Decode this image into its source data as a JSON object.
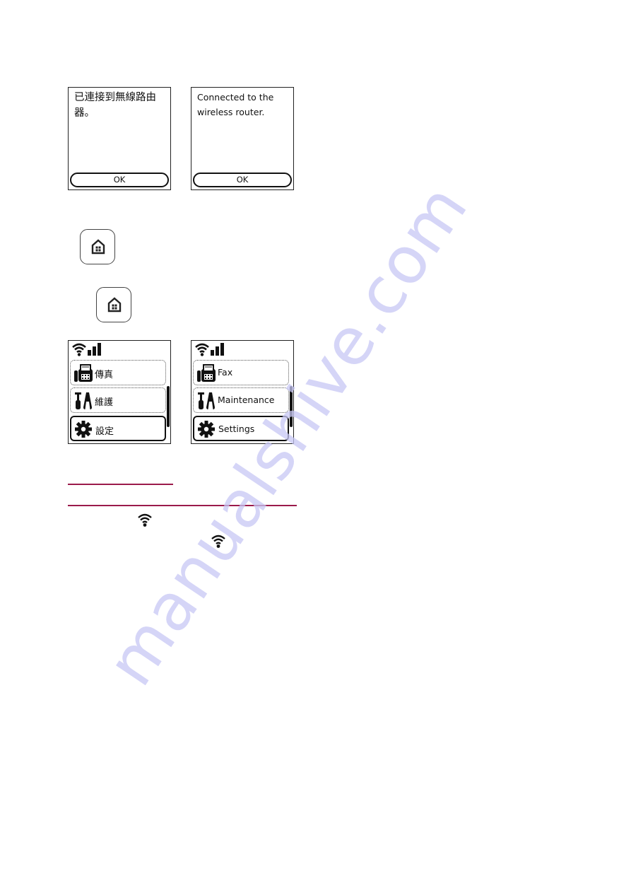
{
  "screens_confirmation": [
    {
      "language": "zh-TW",
      "message": "已連接到無線路由器。",
      "ok_label": "OK"
    },
    {
      "language": "en",
      "message": "Connected to the wireless router.",
      "ok_label": "OK"
    }
  ],
  "home_buttons": [
    {
      "icon": "home-icon"
    },
    {
      "icon": "home-icon"
    }
  ],
  "screens_home_menu": [
    {
      "language": "zh-TW",
      "status_icons": [
        "wifi-icon",
        "signal-strength-icon"
      ],
      "items": [
        {
          "icon": "fax-icon",
          "label": "傳真",
          "selected": false
        },
        {
          "icon": "maintenance-icon",
          "label": "維護",
          "selected": false
        },
        {
          "icon": "gear-icon",
          "label": "設定",
          "selected": true
        }
      ]
    },
    {
      "language": "en",
      "status_icons": [
        "wifi-icon",
        "signal-strength-icon"
      ],
      "items": [
        {
          "icon": "fax-icon",
          "label": "Fax",
          "selected": false
        },
        {
          "icon": "maintenance-icon",
          "label": "Maintenance",
          "selected": false
        },
        {
          "icon": "gear-icon",
          "label": "Settings",
          "selected": true
        }
      ]
    }
  ],
  "inline_icons": [
    "wifi-icon",
    "wifi-icon"
  ],
  "colors": {
    "rule": "#9b1a4b",
    "watermark": "#c8c8f5"
  },
  "watermark": {
    "text": "manualshive.com"
  }
}
